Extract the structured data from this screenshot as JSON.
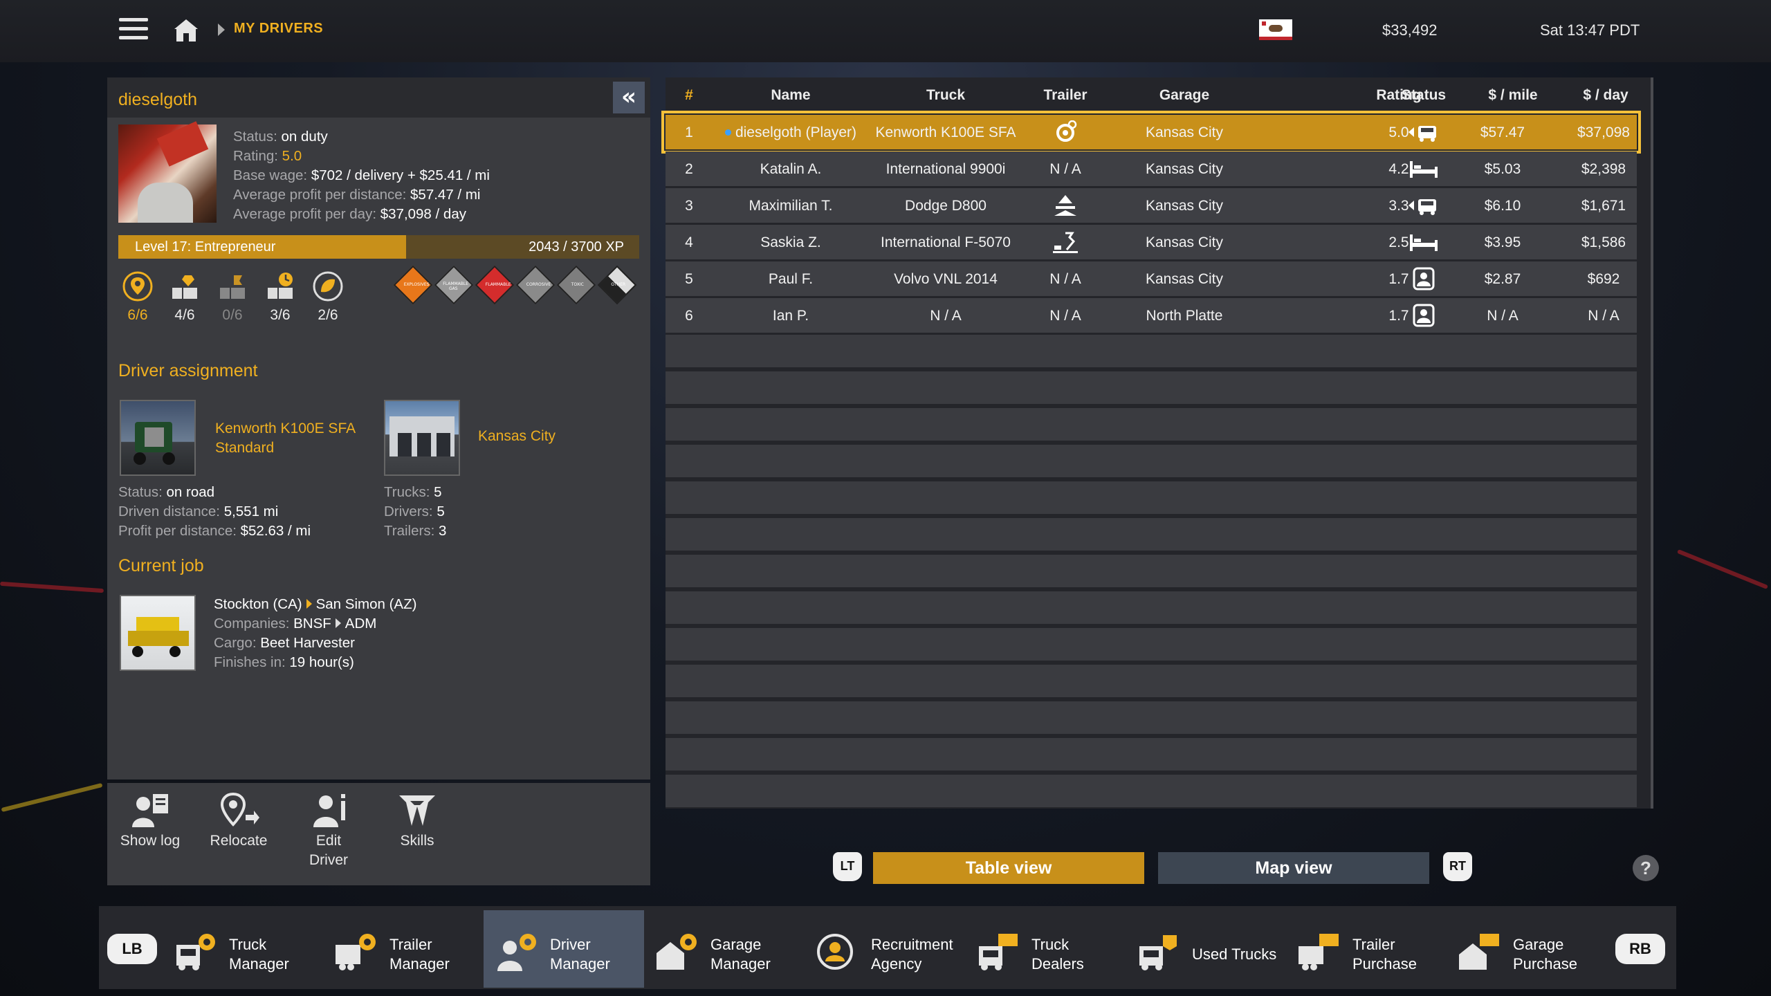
{
  "topbar": {
    "breadcrumb": "MY DRIVERS",
    "money": "$33,492",
    "clock": "Sat 13:47 PDT"
  },
  "driver": {
    "name": "dieselgoth",
    "status_label": "Status:",
    "status": "on duty",
    "rating_label": "Rating:",
    "rating": "5.0",
    "wage_label": "Base wage:",
    "wage": "$702 / delivery + $25.41 / mi",
    "apd_label": "Average profit per distance:",
    "apd": "$57.47 / mi",
    "appd_label": "Average profit per day:",
    "appd": "$37,098 / day",
    "level": "Level 17: Entrepreneur",
    "xp": "2043 / 3700 XP",
    "xp_progress": 0.552,
    "skills": [
      "6/6",
      "4/6",
      "0/6",
      "3/6",
      "2/6"
    ],
    "adr_labels": [
      "EXPLOSIVES",
      "FLAMMABLE GAS",
      "FLAMMABLE",
      "CORROSIVE",
      "TOXIC",
      "OTHER"
    ]
  },
  "assignment": {
    "title": "Driver assignment",
    "truck_line1": "Kenworth  K100E SFA",
    "truck_line2": "Standard",
    "garage": "Kansas City",
    "truck_stats": [
      {
        "k": "Status:",
        "v": "on road"
      },
      {
        "k": "Driven distance:",
        "v": "5,551 mi"
      },
      {
        "k": "Profit per distance:",
        "v": "$52.63 / mi"
      }
    ],
    "garage_stats": [
      {
        "k": "Trucks:",
        "v": "5"
      },
      {
        "k": "Drivers:",
        "v": "5"
      },
      {
        "k": "Trailers:",
        "v": "3"
      }
    ]
  },
  "job": {
    "title": "Current job",
    "from": "Stockton (CA)",
    "to": "San Simon (AZ)",
    "companies_label": "Companies:",
    "company_from": "BNSF",
    "company_to": "ADM",
    "cargo_label": "Cargo:",
    "cargo": "Beet Harvester",
    "finishes_label": "Finishes in:",
    "finishes": "19 hour(s)"
  },
  "actions": {
    "show_log": "Show log",
    "relocate": "Relocate",
    "edit_driver_1": "Edit",
    "edit_driver_2": "Driver",
    "skills": "Skills"
  },
  "table": {
    "headers": [
      "#",
      "Name",
      "Truck",
      "Trailer",
      "Garage",
      "Rating",
      "Status",
      "$ / mile",
      "$ / day"
    ],
    "rows": [
      {
        "num": "1",
        "name": "dieselgoth (Player)",
        "truck": "Kenworth  K100E SFA",
        "trailer": "",
        "trailer_icon": "gear-trailer-icon",
        "garage": "Kansas City",
        "rating": "5.0",
        "status_icon": "driving-icon",
        "mile": "$57.47",
        "day": "$37,098"
      },
      {
        "num": "2",
        "name": "Katalin A.",
        "truck": "International 9900i",
        "trailer": "N / A",
        "trailer_icon": "",
        "garage": "Kansas City",
        "rating": "4.2",
        "status_icon": "resting-icon",
        "mile": "$5.03",
        "day": "$2,398"
      },
      {
        "num": "3",
        "name": "Maximilian T.",
        "truck": "Dodge D800",
        "trailer": "",
        "trailer_icon": "trailer-attached-icon",
        "garage": "Kansas City",
        "rating": "3.3",
        "status_icon": "driving-icon",
        "mile": "$6.10",
        "day": "$1,671"
      },
      {
        "num": "4",
        "name": "Saskia Z.",
        "truck": "International F-5070",
        "trailer": "",
        "trailer_icon": "trailer-loading-icon",
        "garage": "Kansas City",
        "rating": "2.5",
        "status_icon": "resting-icon",
        "mile": "$3.95",
        "day": "$1,586"
      },
      {
        "num": "5",
        "name": "Paul F.",
        "truck": "Volvo VNL 2014",
        "trailer": "N / A",
        "trailer_icon": "",
        "garage": "Kansas City",
        "rating": "1.7",
        "status_icon": "idle-driver-icon",
        "mile": "$2.87",
        "day": "$692"
      },
      {
        "num": "6",
        "name": "Ian P.",
        "truck": "N / A",
        "trailer": "N / A",
        "trailer_icon": "",
        "garage": "North Platte",
        "rating": "1.7",
        "status_icon": "idle-driver-icon",
        "mile": "N / A",
        "day": "N / A"
      }
    ]
  },
  "views": {
    "lt": "LT",
    "rt": "RT",
    "table": "Table view",
    "map": "Map view",
    "help": "?"
  },
  "nav": {
    "lb": "LB",
    "rb": "RB",
    "items": [
      {
        "l1": "Truck",
        "l2": "Manager"
      },
      {
        "l1": "Trailer",
        "l2": "Manager"
      },
      {
        "l1": "Driver",
        "l2": "Manager"
      },
      {
        "l1": "Garage",
        "l2": "Manager"
      },
      {
        "l1": "Recruitment",
        "l2": "Agency"
      },
      {
        "l1": "Truck",
        "l2": "Dealers"
      },
      {
        "l1": "Used Trucks",
        "l2": ""
      },
      {
        "l1": "Trailer",
        "l2": "Purchase"
      },
      {
        "l1": "Garage",
        "l2": "Purchase"
      }
    ]
  },
  "colors": {
    "accent": "#f0b020",
    "selected_row": "#c8901a",
    "active_nav": "#4b5566"
  }
}
